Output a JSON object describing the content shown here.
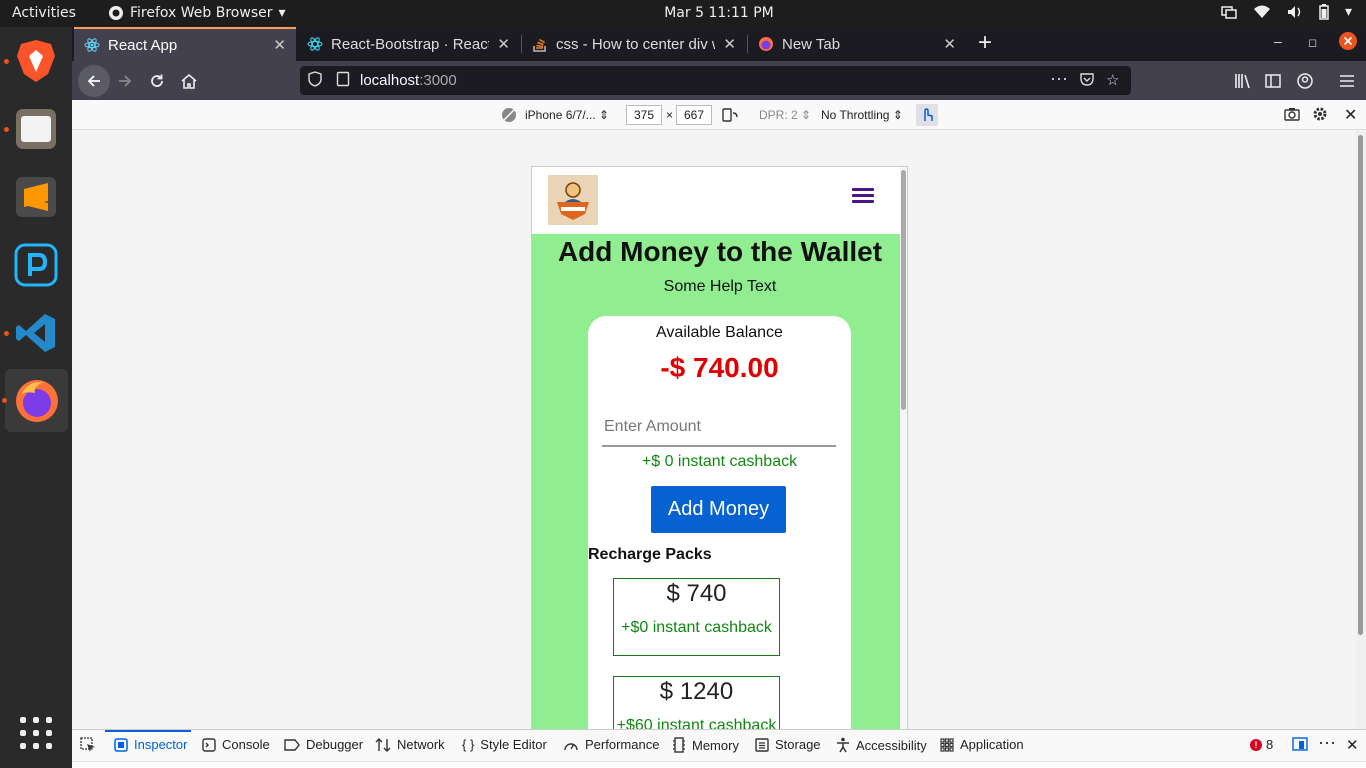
{
  "desktop": {
    "activities": "Activities",
    "app_menu": "Firefox Web Browser",
    "clock": "Mar 5  11:11 PM"
  },
  "browser": {
    "tabs": [
      {
        "title": "React App",
        "active": true,
        "icon": "react-icon"
      },
      {
        "title": "React-Bootstrap · React-B",
        "active": false,
        "icon": "react-bootstrap-icon"
      },
      {
        "title": "css - How to center div w",
        "active": false,
        "icon": "stackoverflow-icon"
      },
      {
        "title": "New Tab",
        "active": false,
        "icon": "firefox-icon"
      }
    ],
    "url_host": "localhost",
    "url_port": ":3000"
  },
  "rdm": {
    "device": "iPhone 6/7/...",
    "width": "375",
    "times": "×",
    "height": "667",
    "dpr": "DPR: 2",
    "throttling": "No Throttling"
  },
  "app": {
    "page_title": "Add Money to the Wallet",
    "help_text": "Some Help Text",
    "balance_label": "Available Balance",
    "balance_value": "-$ 740.00",
    "amount_placeholder": "Enter Amount",
    "cashback_text": "+$ 0 instant cashback",
    "add_button": "Add Money",
    "packs_title": "Recharge Packs",
    "packs": [
      {
        "amount": "$ 740",
        "cashback": "+$0 instant cashback"
      },
      {
        "amount": "$ 1240",
        "cashback": "+$60 instant cashback"
      }
    ]
  },
  "devtools": {
    "tabs": [
      "Inspector",
      "Console",
      "Debugger",
      "Network",
      "Style Editor",
      "Performance",
      "Memory",
      "Storage",
      "Accessibility",
      "Application"
    ],
    "error_count": "8"
  },
  "colors": {
    "page_bg": "#90ee90",
    "balance": "#e00000",
    "cashback": "#118811",
    "button": "#0762d1",
    "hamburger": "#4b148f"
  }
}
